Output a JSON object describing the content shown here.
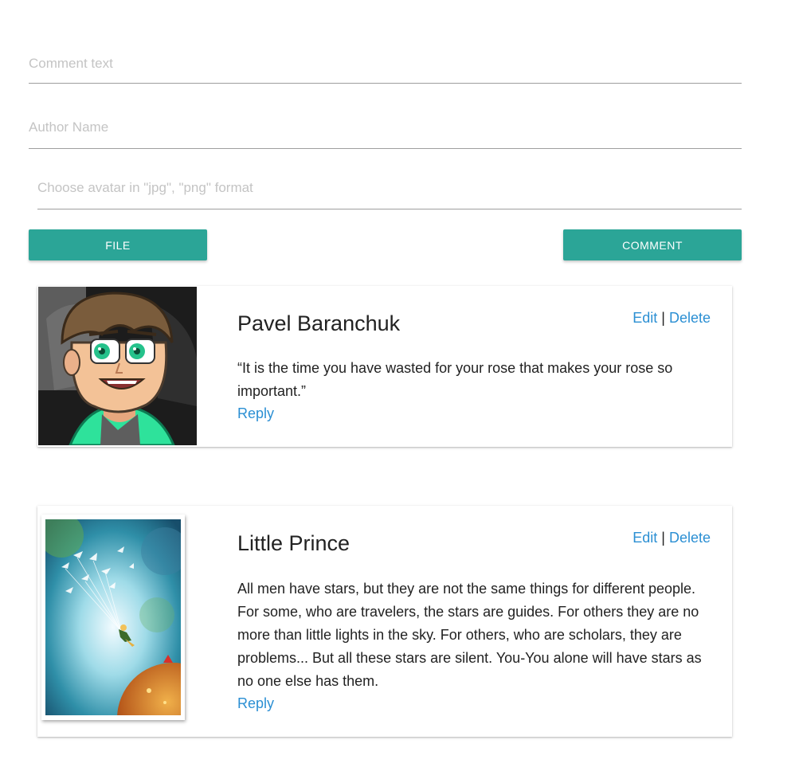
{
  "form": {
    "comment_placeholder": "Comment text",
    "author_placeholder": "Author Name",
    "avatar_placeholder": "Choose avatar in \"jpg\", \"png\" format",
    "file_button": "FILE",
    "comment_button": "COMMENT"
  },
  "colors": {
    "accent": "#2ba597",
    "link": "#2b8fd3"
  },
  "comments": [
    {
      "author": "Pavel Baranchuk",
      "text": "“It is the time you have wasted for your rose that makes your rose so important.”",
      "edit": "Edit",
      "separator": "|",
      "delete": "Delete",
      "reply": "Reply",
      "avatar": "cartoon-boy-avatar"
    },
    {
      "author": "Little Prince",
      "text": "All men have stars, but they are not the same things for different people. For some, who are travelers, the stars are guides. For others they are no more than little lights in the sky. For others, who are scholars, they are problems... But all these stars are silent. You-You alone will have stars as no one else has them.",
      "edit": "Edit",
      "separator": "|",
      "delete": "Delete",
      "reply": "Reply",
      "avatar": "little-prince-painting-avatar"
    }
  ]
}
